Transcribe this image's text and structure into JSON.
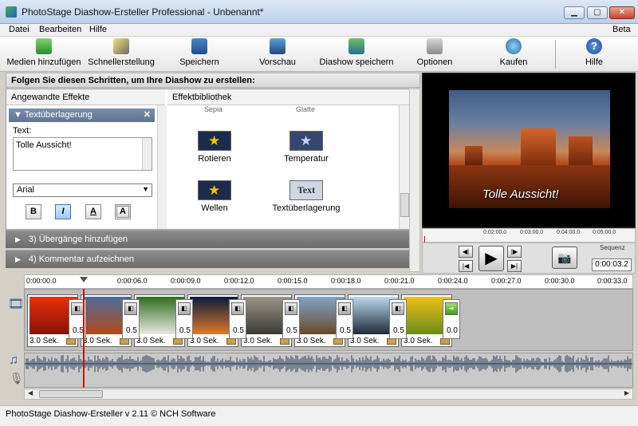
{
  "window": {
    "title": "PhotoStage Diashow-Ersteller Professional - Unbenannt*",
    "beta_label": "Beta"
  },
  "menu": [
    "Datei",
    "Bearbeiten",
    "Hilfe"
  ],
  "toolbar": [
    {
      "label": "Medien hinzufügen",
      "icon": "add-media-icon"
    },
    {
      "label": "Schnellerstellung",
      "icon": "magic-wand-icon"
    },
    {
      "label": "Speichern",
      "icon": "save-icon"
    },
    {
      "label": "Vorschau",
      "icon": "film-preview-icon"
    },
    {
      "label": "Diashow speichern",
      "icon": "save-slideshow-icon"
    },
    {
      "label": "Optionen",
      "icon": "options-icon"
    },
    {
      "label": "Kaufen",
      "icon": "buy-icon"
    },
    {
      "label": "Hilfe",
      "icon": "help-icon"
    }
  ],
  "steps_header": "Folgen Sie diesen Schritten, um Ihre Diashow zu erstellen:",
  "applied_effects": {
    "column_title": "Angewandte Effekte",
    "panel_title": "Textüberlagerung",
    "text_label": "Text:",
    "text_value": "Tolle Aussicht!",
    "font": "Arial",
    "format_buttons": [
      "B",
      "I",
      "A",
      "A"
    ]
  },
  "library": {
    "column_title": "Effektbibliothek",
    "cut_labels": [
      "Sepia",
      "Glatte"
    ],
    "items": [
      {
        "label": "Rotieren"
      },
      {
        "label": "Temperatur"
      },
      {
        "label": "Wellen"
      },
      {
        "label": "Textüberlagerung",
        "thumb_text": "Text"
      }
    ]
  },
  "steps": [
    {
      "label": "3)  Übergänge hinzufügen"
    },
    {
      "label": "4)  Kommentar aufzeichnen"
    }
  ],
  "preview": {
    "caption": "Tolle Aussicht!",
    "ruler": [
      "0:02:00.0",
      "0:03:00.0",
      "0:04:00.0",
      "0:05:00.0"
    ],
    "sequence_label": "Sequenz",
    "time": "0:00:03.2"
  },
  "timeline": {
    "ruler": [
      "0:00:00.0",
      "0:00:06.0",
      "0:00:09.0",
      "0:00:12.0",
      "0:00:15.0",
      "0:00:18.0",
      "0:00:21.0",
      "0:00:24.0",
      "0:00:27.0",
      "0:00:30.0",
      "0:00:33.0"
    ],
    "clips": [
      {
        "name": "flower",
        "duration": "3.0 Sek.",
        "colors": [
          "#e8300a",
          "#8a1204"
        ]
      },
      {
        "name": "desert",
        "duration": "3.0 Sek.",
        "colors": [
          "#4d6c9a",
          "#b3481a"
        ]
      },
      {
        "name": "daisies",
        "duration": "3.0 Sek.",
        "colors": [
          "#2f6d1e",
          "#e9e9e0"
        ]
      },
      {
        "name": "jellyfish",
        "duration": "3.0 Sek.",
        "colors": [
          "#0a1a3a",
          "#e07a2a"
        ]
      },
      {
        "name": "koala",
        "duration": "3.0 Sek.",
        "colors": [
          "#9a948a",
          "#3a3a34"
        ]
      },
      {
        "name": "castle",
        "duration": "3.0 Sek.",
        "colors": [
          "#7fa3c8",
          "#6a4a2a"
        ]
      },
      {
        "name": "penguins",
        "duration": "3.0 Sek.",
        "colors": [
          "#bcd8ef",
          "#1e2a38"
        ]
      },
      {
        "name": "tulips",
        "duration": "3.0 Sek.",
        "colors": [
          "#f0c21a",
          "#6a8a1a"
        ]
      }
    ],
    "transitions": [
      "0.5",
      "0.5",
      "0.5",
      "0.5",
      "0.5",
      "0.5",
      "0.5",
      "0.0"
    ]
  },
  "status": "PhotoStage Diashow-Ersteller v 2.11 © NCH Software"
}
